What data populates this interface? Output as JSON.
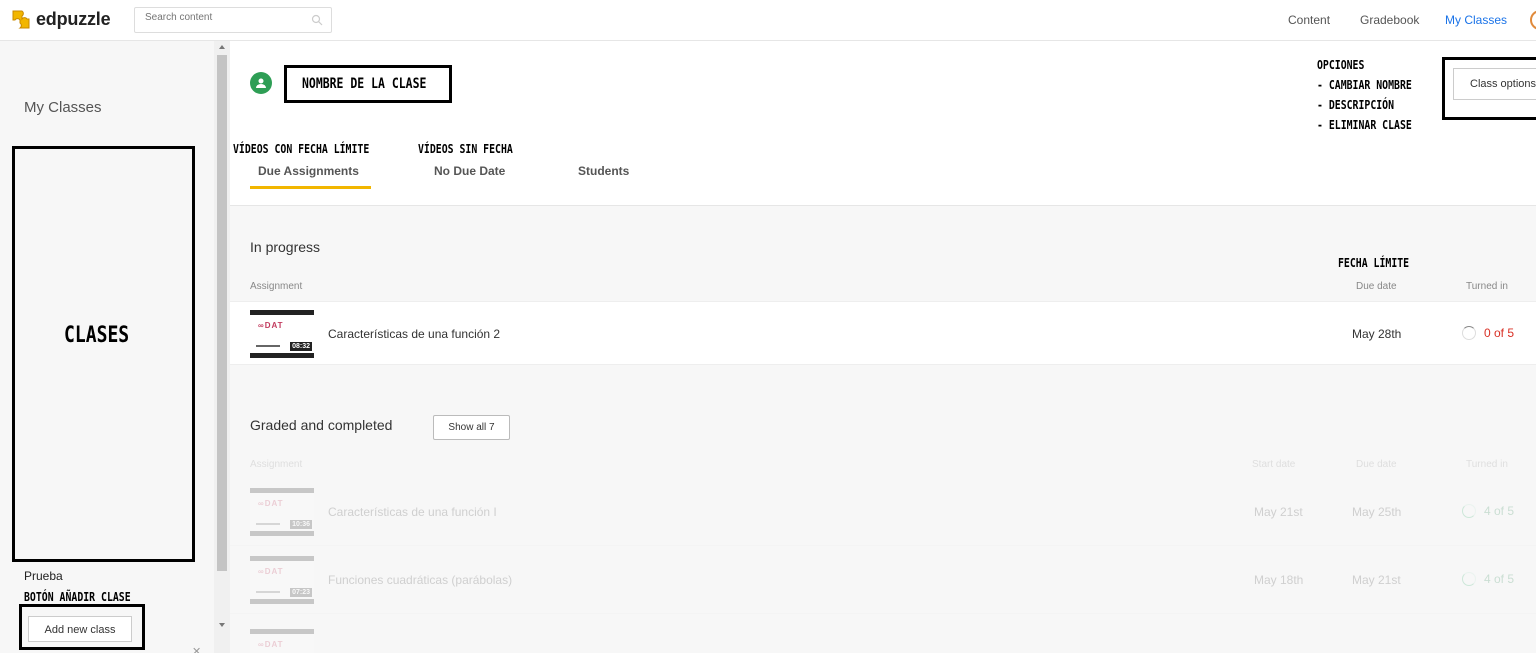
{
  "topbar": {
    "logo_text": "edpuzzle",
    "search_placeholder": "Search content",
    "nav": [
      "Content",
      "Gradebook",
      "My Classes"
    ],
    "active_nav": "My Classes",
    "accent_color": "#1a73e8"
  },
  "sidebar": {
    "title": "My Classes",
    "class_item": "Prueba",
    "add_class_label": "Add new class"
  },
  "header": {
    "class_options_label": "Class options"
  },
  "tabs": {
    "items": [
      "Due Assignments",
      "No Due Date",
      "Students"
    ],
    "active": "Due Assignments",
    "underline_color": "#f2b600"
  },
  "in_progress": {
    "title": "In progress",
    "columns": {
      "assignment": "Assignment",
      "due_date": "Due date",
      "turned_in": "Turned in"
    },
    "rows": [
      {
        "title": "Características de una función 2",
        "duration": "08:32",
        "due_date": "May 28th",
        "turned_in": "0 of 5"
      }
    ]
  },
  "graded": {
    "title": "Graded and completed",
    "show_all_label": "Show all 7",
    "columns": {
      "assignment": "Assignment",
      "start_date": "Start date",
      "due_date": "Due date",
      "turned_in": "Turned in"
    },
    "rows": [
      {
        "title": "Características de una función I",
        "duration": "10:36",
        "start_date": "May 21st",
        "due_date": "May 25th",
        "turned_in": "4 of 5"
      },
      {
        "title": "Funciones cuadráticas (parábolas)",
        "duration": "07:23",
        "start_date": "May 18th",
        "due_date": "May 21st",
        "turned_in": "4 of 5"
      }
    ]
  },
  "annotations": {
    "clases": "CLASES",
    "nombre_clase": "NOMBRE DE LA CLASE",
    "boton_anadir": "BOTÓN AÑADIR CLASE",
    "videos_fecha": "VÍDEOS CON FECHA LÍMITE",
    "videos_sin_fecha": "VÍDEOS SIN FECHA",
    "fecha_limite": "FECHA LÍMITE",
    "opciones_title": "OPCIONES",
    "opciones_items": [
      "- CAMBIAR NOMBRE",
      "- DESCRIPCIÓN",
      "- ELIMINAR CLASE"
    ]
  }
}
